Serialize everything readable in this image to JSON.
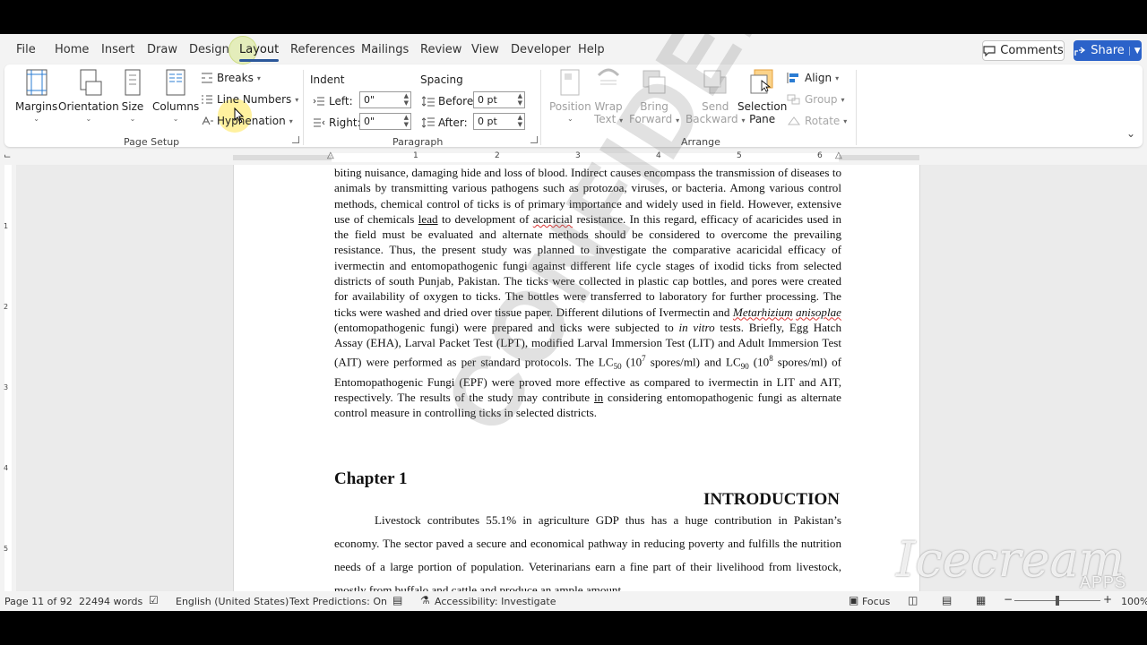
{
  "menu": {
    "tabs": [
      "File",
      "Home",
      "Insert",
      "Draw",
      "Design",
      "Layout",
      "References",
      "Mailings",
      "Review",
      "View",
      "Developer",
      "Help"
    ],
    "active": "Layout",
    "comments": "Comments",
    "share": "Share"
  },
  "ribbon": {
    "page_setup": {
      "margins": "Margins",
      "orientation": "Orientation",
      "size": "Size",
      "columns": "Columns",
      "breaks": "Breaks",
      "line_numbers": "Line Numbers",
      "hyphenation": "Hyphenation",
      "label": "Page Setup"
    },
    "paragraph": {
      "indent": "Indent",
      "spacing": "Spacing",
      "left_label": "Left:",
      "left_value": "0\"",
      "right_label": "Right:",
      "right_value": "0\"",
      "before_label": "Before:",
      "before_value": "0 pt",
      "after_label": "After:",
      "after_value": "0 pt",
      "label": "Paragraph"
    },
    "arrange": {
      "position": "Position",
      "wrap1": "Wrap",
      "wrap2": "Text",
      "bring1": "Bring",
      "bring2": "Forward",
      "send1": "Send",
      "send2": "Backward",
      "sel1": "Selection",
      "sel2": "Pane",
      "align": "Align",
      "group": "Group",
      "rotate": "Rotate",
      "label": "Arrange"
    }
  },
  "ruler": {
    "numbers": [
      "1",
      "2",
      "3",
      "4",
      "5",
      "6"
    ],
    "vnumbers": [
      "1",
      "2",
      "3",
      "4",
      "5"
    ]
  },
  "doc": {
    "p1": "biting nuisance, damaging hide and loss of blood. Indirect causes encompass the transmission of diseases to animals by transmitting various pathogens such as protozoa, viruses, or bacteria. Among various control methods, chemical control of ticks is of primary importance and widely used in field. However, extensive use of chemicals",
    "lead": "lead",
    "p1b": "to development of",
    "acaricial": "acaricial",
    "p1c": "resistance. In this regard, efficacy of acaricides used in the field must be evaluated and alternate methods should be considered to overcome the prevailing resistance. Thus, the present study was planned to investigate the comparative acaricidal efficacy of ivermectin and entomopathogenic fungi against different life cycle stages of ixodid ticks from selected districts of south Punjab, Pakistan. The ticks were collected in plastic cap bottles, and pores were created for availability of oxygen to ticks. The bottles were transferred to laboratory for further processing. The ticks were washed and dried over tissue paper. Different dilutions of Ivermectin and",
    "metarhizium": "Metarhizium",
    "anisoplae": "anisoplae",
    "p1d": "(entomopathogenic fungi) were prepared and ticks were subjected to",
    "invitro": "in vitro",
    "p1e": "tests. Briefly, Egg Hatch Assay (EHA), Larval Packet Test (LPT), modified Larval Immersion Test (LIT) and Adult Immersion Test (AIT) were performed as per standard protocols. The LC",
    "sub50": "50",
    "p1f": "(10",
    "sup7": "7",
    "p1g": "spores/ml) and LC",
    "sub90": "90",
    "p1h": "(10",
    "sup8": "8",
    "p1i": "spores/ml) of Entomopathogenic Fungi (EPF) were proved more effective as compared to ivermectin in LIT and AIT, respectively. The results of the study may contribute",
    "in": "in",
    "p1j": "considering entomopathogenic fungi as alternate control measure in controlling ticks in selected districts.",
    "chapter": "Chapter 1",
    "intro": "INTRODUCTION",
    "p2": "Livestock contributes 55.1% in agriculture GDP thus has a huge contribution in Pakistan’s economy. The sector paved a secure and economical pathway in reducing poverty and fulfills the nutrition needs of a large portion of population. Veterinarians earn a fine part of their livelihood from livestock, mostly from buffalo and cattle and produce an ample amount",
    "watermark": "CONFIDENTIAL"
  },
  "watermark_app": {
    "name": "Icecream",
    "sub": "APPS"
  },
  "status": {
    "page": "Page 11 of 92",
    "words": "22494 words",
    "language": "English (United States)",
    "predictions": "Text Predictions: On",
    "accessibility": "Accessibility: Investigate",
    "focus": "Focus",
    "zoom": "100%"
  }
}
